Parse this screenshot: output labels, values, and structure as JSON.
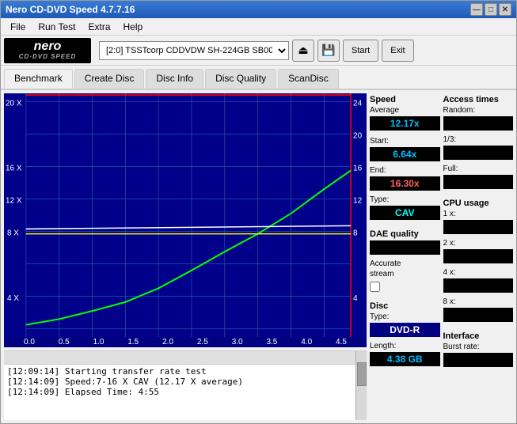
{
  "window": {
    "title": "Nero CD-DVD Speed 4.7.7.16",
    "controls": [
      "—",
      "□",
      "✕"
    ]
  },
  "menu": {
    "items": [
      "File",
      "Run Test",
      "Extra",
      "Help"
    ]
  },
  "toolbar": {
    "logo_text": "nero",
    "logo_sub": "CD·DVD SPEED",
    "drive_label": "[2:0]  TSSTcorp CDDVDW SH-224GB SB00",
    "start_label": "Start",
    "exit_label": "Exit"
  },
  "tabs": [
    {
      "label": "Benchmark",
      "active": true
    },
    {
      "label": "Create Disc",
      "active": false
    },
    {
      "label": "Disc Info",
      "active": false
    },
    {
      "label": "Disc Quality",
      "active": false
    },
    {
      "label": "ScanDisc",
      "active": false
    }
  ],
  "chart": {
    "y_left_labels": [
      "20 X",
      "16 X",
      "12 X",
      "8 X",
      "4 X"
    ],
    "y_right_labels": [
      "24",
      "20",
      "16",
      "12",
      "8",
      "4"
    ],
    "x_labels": [
      "0.0",
      "0.5",
      "1.0",
      "1.5",
      "2.0",
      "2.5",
      "3.0",
      "3.5",
      "4.0",
      "4.5"
    ]
  },
  "stats": {
    "speed_label": "Speed",
    "average_label": "Average",
    "average_value": "12.17x",
    "start_label": "Start:",
    "start_value": "6.64x",
    "end_label": "End:",
    "end_value": "16.30x",
    "type_label": "Type:",
    "type_value": "CAV",
    "dae_label": "DAE quality",
    "dae_value": "",
    "accurate_label": "Accurate",
    "stream_label": "stream",
    "disc_label": "Disc",
    "disc_type_label": "Type:",
    "disc_type_value": "DVD-R",
    "length_label": "Length:",
    "length_value": "4.38 GB"
  },
  "access_times": {
    "label": "Access times",
    "random_label": "Random:",
    "random_value": "",
    "onethird_label": "1/3:",
    "onethird_value": "",
    "full_label": "Full:",
    "full_value": ""
  },
  "cpu": {
    "label": "CPU usage",
    "x1_label": "1 x:",
    "x1_value": "",
    "x2_label": "2 x:",
    "x2_value": "",
    "x4_label": "4 x:",
    "x4_value": "",
    "x8_label": "8 x:",
    "x8_value": ""
  },
  "interface": {
    "label": "Interface",
    "burst_label": "Burst rate:",
    "burst_value": ""
  },
  "log": {
    "entries": [
      "[12:09:14]  Starting transfer rate test",
      "[12:14:09]  Speed:7-16 X CAV (12.17 X average)",
      "[12:14:09]  Elapsed Time: 4:55"
    ]
  }
}
